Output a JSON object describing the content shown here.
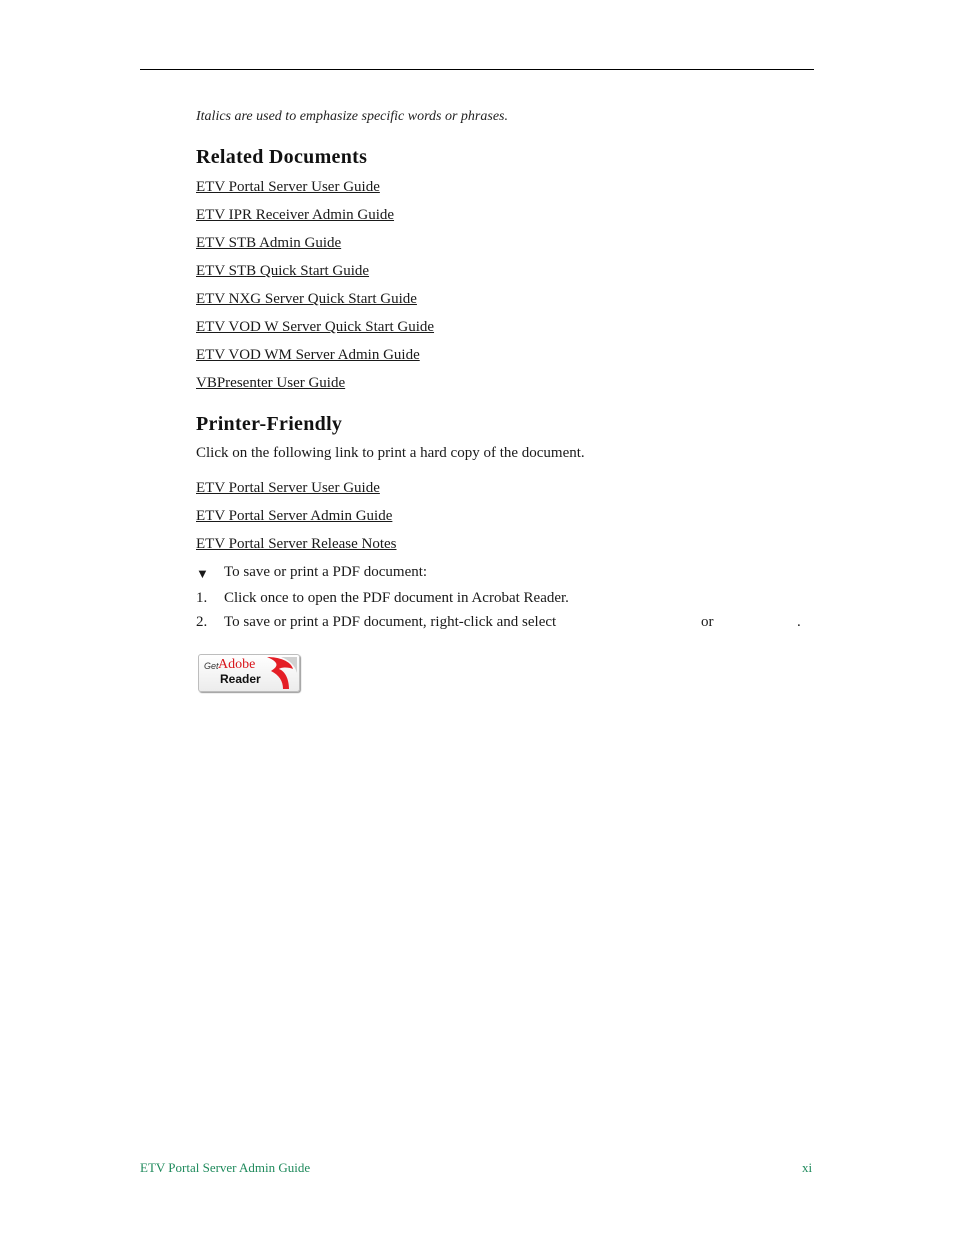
{
  "intro": {
    "italic_note": "Italics are used to emphasize specific words or phrases."
  },
  "related_documents": {
    "heading": "Related Documents",
    "links": [
      "ETV Portal Server User Guide",
      "ETV IPR Receiver Admin Guide",
      "ETV STB Admin Guide",
      "ETV STB Quick Start Guide",
      "ETV NXG Server Quick Start Guide",
      "ETV VOD W Server Quick Start Guide",
      "ETV VOD WM Server Admin Guide",
      "VBPresenter User Guide"
    ]
  },
  "printer_friendly": {
    "heading": "Printer-Friendly",
    "description": "Click on the following link to print a hard copy of the document.",
    "links": [
      "ETV Portal Server User Guide",
      "ETV Portal Server Admin Guide",
      "ETV Portal Server Release Notes"
    ],
    "procedure": {
      "bullet": "▼",
      "title": "To save or print a PDF document:",
      "steps": [
        {
          "num": "1.",
          "text": "Click once to open the PDF document in Acrobat Reader."
        },
        {
          "num": "2.",
          "text": "To save or print a PDF document, right-click and select",
          "or": "or",
          "end": "."
        }
      ]
    },
    "adobe_badge": {
      "get": "Get",
      "brand": "Adobe",
      "product": "Reader"
    }
  },
  "footer": {
    "title": "ETV Portal Server Admin Guide",
    "page": "xi"
  }
}
